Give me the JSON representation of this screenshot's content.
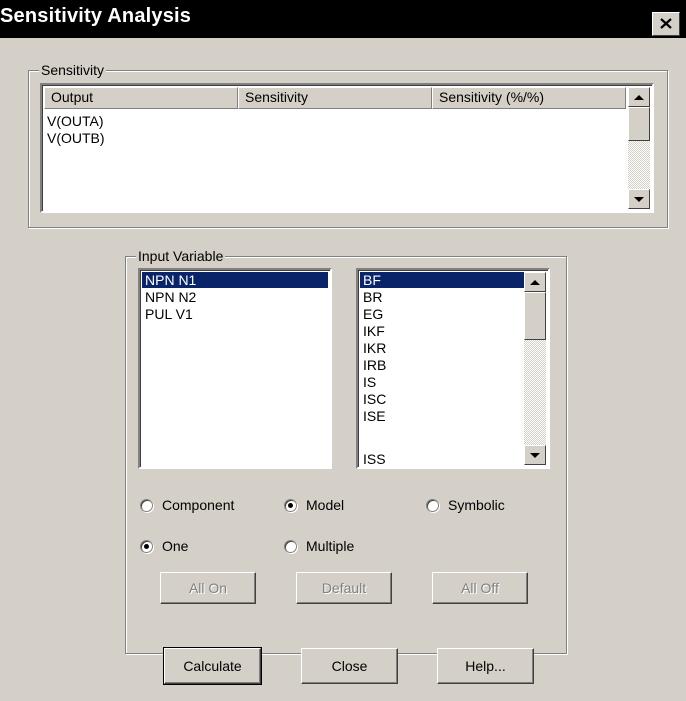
{
  "window": {
    "title": "Sensitivity Analysis",
    "close_icon": "close-icon"
  },
  "sensitivity": {
    "group_label": "Sensitivity",
    "columns": [
      "Output",
      "Sensitivity",
      "Sensitivity (%/%)"
    ],
    "rows": [
      "V(OUTA)",
      "V(OUTB)"
    ]
  },
  "input_variable": {
    "group_label": "Input Variable",
    "components": [
      {
        "label": "NPN N1",
        "selected": true
      },
      {
        "label": "NPN N2",
        "selected": false
      },
      {
        "label": "PUL V1",
        "selected": false
      }
    ],
    "parameters": [
      {
        "label": "BF",
        "selected": true
      },
      {
        "label": "BR",
        "selected": false
      },
      {
        "label": "EG",
        "selected": false
      },
      {
        "label": "IKF",
        "selected": false
      },
      {
        "label": "IKR",
        "selected": false
      },
      {
        "label": "IRB",
        "selected": false
      },
      {
        "label": "IS",
        "selected": false
      },
      {
        "label": "ISC",
        "selected": false
      },
      {
        "label": "ISE",
        "selected": false
      },
      {
        "label": "ISS",
        "selected": false
      }
    ],
    "mode_radios": [
      {
        "label": "Component",
        "checked": false
      },
      {
        "label": "Model",
        "checked": true
      },
      {
        "label": "Symbolic",
        "checked": false
      }
    ],
    "scope_radios": [
      {
        "label": "One",
        "checked": true
      },
      {
        "label": "Multiple",
        "checked": false
      }
    ],
    "buttons": {
      "all_on": "All On",
      "default": "Default",
      "all_off": "All Off"
    }
  },
  "footer": {
    "calculate": "Calculate",
    "close": "Close",
    "help": "Help..."
  },
  "colors": {
    "dialog_bg": "#d4d0c8",
    "titlebar_bg": "#000000",
    "selection_bg": "#0a246a",
    "disabled_text": "#808080"
  }
}
